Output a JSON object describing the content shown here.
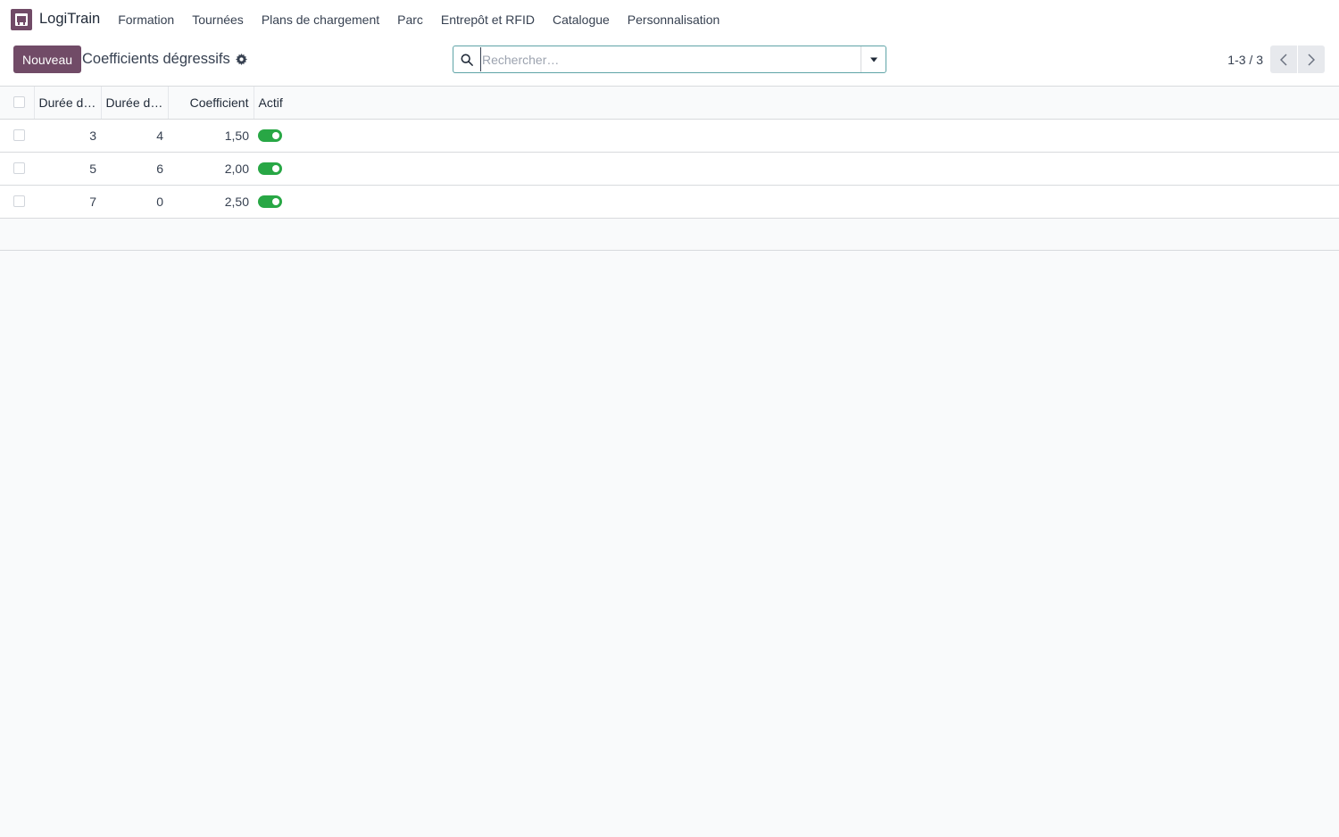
{
  "app": {
    "name": "LogiTrain",
    "brand_color": "#714b67"
  },
  "nav": {
    "items": [
      {
        "label": "Formation"
      },
      {
        "label": "Tournées"
      },
      {
        "label": "Plans de chargement"
      },
      {
        "label": "Parc"
      },
      {
        "label": "Entrepôt et RFID"
      },
      {
        "label": "Catalogue"
      },
      {
        "label": "Personnalisation"
      }
    ]
  },
  "control_panel": {
    "new_label": "Nouveau",
    "title": "Coefficients dégressifs",
    "search": {
      "placeholder": "Rechercher…",
      "value": ""
    },
    "pager": "1-3 / 3"
  },
  "table": {
    "columns": [
      "Durée d'…",
      "Durée d'…",
      "Coefficient",
      "Actif"
    ],
    "rows": [
      {
        "duration_min": "3",
        "duration_max": "4",
        "coefficient": "1,50",
        "active": true
      },
      {
        "duration_min": "5",
        "duration_max": "6",
        "coefficient": "2,00",
        "active": true
      },
      {
        "duration_min": "7",
        "duration_max": "0",
        "coefficient": "2,50",
        "active": true
      }
    ],
    "toggle_on_color": "#28a745"
  }
}
